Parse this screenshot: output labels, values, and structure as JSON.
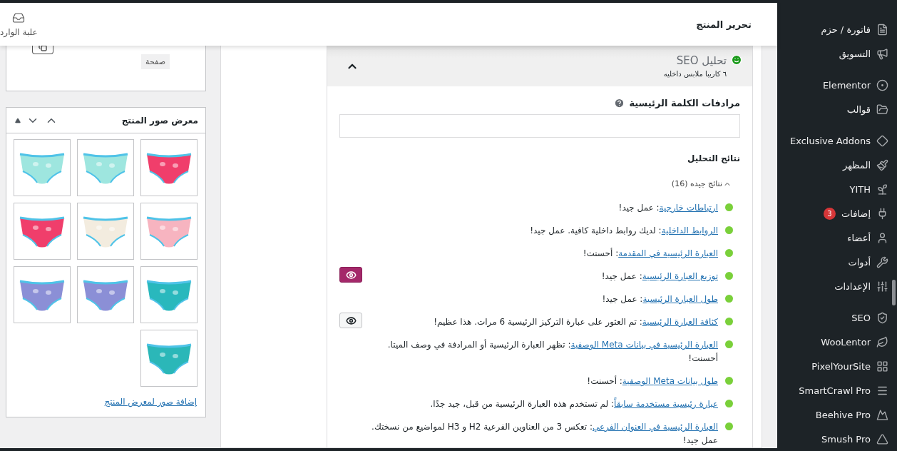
{
  "header": {
    "title": "تحرير المنتج",
    "inbox_label": "علبة الوارد"
  },
  "page_box": {
    "button": "صفحة"
  },
  "gallery": {
    "title": "معرض صور المنتج",
    "add_link": "إضافة صور لمعرض المنتج"
  },
  "seo": {
    "title": "تحليل SEO",
    "subtitle": "٦ كاريبا ملابس داخليه",
    "expanded": true,
    "synonyms_label": "مرادفات الكلمة الرئيسية",
    "results_heading": "نتائج التحليل",
    "good_group": {
      "label": "نتائج جيده (16)",
      "expanded": true
    },
    "results": [
      {
        "link": "ارتباطات خارجية",
        "text": ": عمل جيد!",
        "color": "#7ad03a"
      },
      {
        "link": "الروابط الداخلية",
        "text": ": لديك روابط داخلية كافية. عمل جيد!",
        "color": "#7ad03a"
      },
      {
        "link": "العبارة الرئيسية في المقدمة",
        "text": ": أحسنت!",
        "color": "#7ad03a"
      },
      {
        "link": "توزيع العبارة الرئيسية",
        "text": ": عمل جيد!",
        "color": "#7ad03a",
        "eye_button": {
          "pressed": true
        }
      },
      {
        "link": "طول العبارة الرئيسية",
        "text": ": عمل جيد!",
        "color": "#7ad03a"
      },
      {
        "link": "كثافة العبارة الرئيسية",
        "text": ": تم العثور على عبارة التركيز الرئيسية 6 مرات. هذا عظيم!",
        "color": "#7ad03a",
        "eye_button": {
          "pressed": false
        }
      },
      {
        "link": "العبارة الرئيسية في بيانات Meta الوصفية",
        "text": ": تظهر العبارة الرئيسية أو المرادفة في وصف الميتا. أحسنت!",
        "color": "#7ad03a"
      },
      {
        "link": "طول بيانات Meta الوصفية",
        "text": ": أحسنت!",
        "color": "#7ad03a"
      },
      {
        "link": "عبارة رئيسية مستخدمة سابقاً",
        "text": ": لم تستخدم هذه العبارة الرئيسية من قبل، جيد جدًا.",
        "color": "#7ad03a"
      },
      {
        "link": "العبارة الرئيسية في العنوان الفرعي",
        "text": ": تعكس 3 من العناوين الفرعية H2 و H3 لمواضيع من نسختك. عمل جيد!",
        "color": "#7ad03a"
      }
    ]
  },
  "sidebar": {
    "groups": [
      [
        {
          "label": "فاتورة / حزم"
        },
        {
          "label": "التسويق"
        }
      ],
      [
        {
          "label": "Elementor"
        },
        {
          "label": "قوالب"
        }
      ],
      [
        {
          "label": "Exclusive Addons"
        },
        {
          "label": "المظهر"
        },
        {
          "label": "YITH"
        },
        {
          "label": "إضافات",
          "badge": "3"
        },
        {
          "label": "أعضاء"
        },
        {
          "label": "أدوات"
        },
        {
          "label": "الإعدادات"
        }
      ],
      [
        {
          "label": "SEO"
        },
        {
          "label": "WooLentor"
        },
        {
          "label": "PixelYourSite"
        },
        {
          "label": "SmartCrawl Pro"
        },
        {
          "label": "Beehive Pro"
        },
        {
          "label": "Smush Pro"
        }
      ]
    ]
  }
}
